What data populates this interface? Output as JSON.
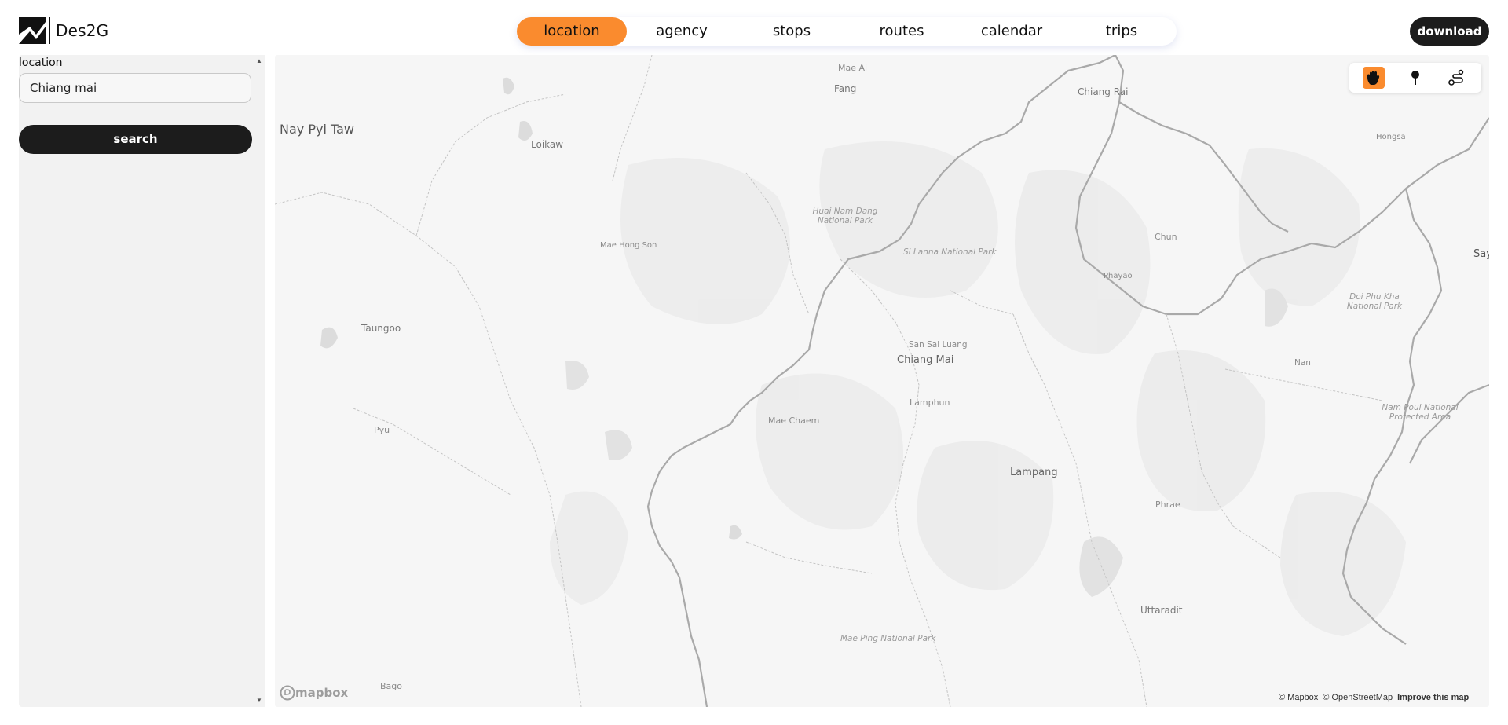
{
  "app": {
    "name": "Des2G"
  },
  "nav": {
    "tabs": [
      {
        "label": "location",
        "active": true
      },
      {
        "label": "agency"
      },
      {
        "label": "stops"
      },
      {
        "label": "routes"
      },
      {
        "label": "calendar"
      },
      {
        "label": "trips"
      }
    ],
    "download_label": "download"
  },
  "sidebar": {
    "location_label": "location",
    "location_value": "Chiang mai",
    "search_label": "search"
  },
  "map": {
    "places": {
      "mae_ai": "Mae Ai",
      "fang": "Fang",
      "chiang_rai": "Chiang Rai",
      "nay_pyi_taw": "Nay Pyi Taw",
      "loikaw": "Loikaw",
      "hongsa": "Hongsa",
      "huai_nam_dang": "Huai Nam Dang National Park",
      "mae_hong_son": "Mae Hong Son",
      "si_lanna": "Si Lanna National Park",
      "chun": "Chun",
      "say": "Say",
      "phayao": "Phayao",
      "doi_phu_kha": "Doi Phu Kha National Park",
      "taungoo": "Taungoo",
      "san_sai_luang": "San Sai Luang",
      "chiang_mai": "Chiang Mai",
      "nan": "Nan",
      "lamphun": "Lamphun",
      "nam_poui": "Nam Poui National Protected Area",
      "mae_chaem": "Mae Chaem",
      "pyu": "Pyu",
      "lampang": "Lampang",
      "phrae": "Phrae",
      "uttaradit": "Uttaradit",
      "mae_ping": "Mae Ping National Park",
      "bago": "Bago"
    },
    "tools": [
      {
        "icon": "hand-icon",
        "active": true
      },
      {
        "icon": "pin-icon"
      },
      {
        "icon": "route-icon"
      }
    ],
    "mapbox_logo": "mapbox",
    "attribution": {
      "mapbox": "© Mapbox",
      "osm": "© OpenStreetMap",
      "improve": "Improve this map"
    }
  },
  "colors": {
    "accent": "#fa8b2e",
    "dark": "#1c1c1c",
    "map_bg": "#f6f6f6"
  }
}
